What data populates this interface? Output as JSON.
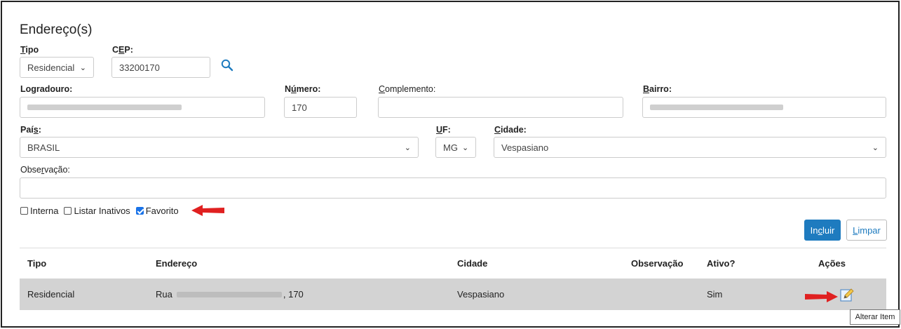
{
  "section": {
    "title": "Endereço(s)"
  },
  "form": {
    "tipo": {
      "label_pre": "",
      "label_u": "T",
      "label_post": "ipo",
      "value": "Residencial"
    },
    "cep": {
      "label_pre": "C",
      "label_u": "E",
      "label_post": "P:",
      "value": "33200170"
    },
    "logradouro": {
      "label": "Logradouro:"
    },
    "numero": {
      "label_pre": "N",
      "label_u": "ú",
      "label_post": "mero:",
      "value": "170"
    },
    "complemento": {
      "label_pre": "",
      "label_u": "C",
      "label_post": "omplemento:",
      "value": ""
    },
    "bairro": {
      "label_pre": "",
      "label_u": "B",
      "label_post": "airro:"
    },
    "pais": {
      "label_pre": "Paí",
      "label_u": "s",
      "label_post": ":",
      "value": "BRASIL"
    },
    "uf": {
      "label_pre": "",
      "label_u": "U",
      "label_post": "F:",
      "value": "MG"
    },
    "cidade": {
      "label_pre": "",
      "label_u": "C",
      "label_post": "idade:",
      "value": "Vespasiano"
    },
    "observacao": {
      "label_pre": "Obse",
      "label_u": "r",
      "label_post": "vação:",
      "value": ""
    }
  },
  "checkboxes": [
    {
      "label": "Interna",
      "checked": false
    },
    {
      "label": "Listar Inativos",
      "checked": false
    },
    {
      "label": "Favorito",
      "checked": true
    }
  ],
  "buttons": {
    "incluir": {
      "pre": "In",
      "u": "c",
      "post": "luir"
    },
    "limpar": {
      "pre": "",
      "u": "L",
      "post": "impar"
    }
  },
  "table": {
    "headers": [
      "Tipo",
      "Endereço",
      "Cidade",
      "Observação",
      "Ativo?",
      "Ações"
    ],
    "rows": [
      {
        "tipo": "Residencial",
        "endereco_prefix": "Rua",
        "endereco_suffix": ", 170",
        "cidade": "Vespasiano",
        "observacao": "",
        "ativo": "Sim"
      }
    ]
  },
  "tooltip": "Alterar Item",
  "colors": {
    "primary": "#1e7bbf",
    "arrow": "#e02020",
    "row_bg": "#d3d3d3"
  },
  "icons": {
    "search": "search-icon",
    "edit": "edit-icon",
    "chevron": "chevron-down-icon"
  }
}
